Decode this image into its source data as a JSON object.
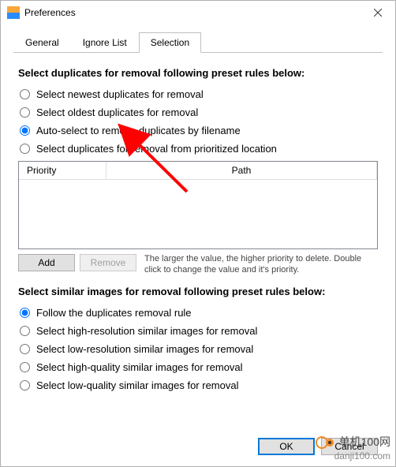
{
  "window": {
    "title": "Preferences"
  },
  "tabs": [
    {
      "label": "General",
      "active": false
    },
    {
      "label": "Ignore List",
      "active": false
    },
    {
      "label": "Selection",
      "active": true
    }
  ],
  "duplicates": {
    "heading": "Select duplicates for removal following preset rules below:",
    "options": [
      {
        "label": "Select newest duplicates for removal",
        "checked": false
      },
      {
        "label": "Select oldest duplicates for removal",
        "checked": false
      },
      {
        "label": "Auto-select to remove duplicates by filename",
        "checked": true
      },
      {
        "label": "Select duplicates for removal from prioritized location",
        "checked": false
      }
    ]
  },
  "priority_table": {
    "columns": {
      "priority": "Priority",
      "path": "Path"
    },
    "rows": []
  },
  "buttons": {
    "add": "Add",
    "remove": "Remove",
    "hint": "The larger the value, the higher priority to delete. Double click to change the value and it's priority."
  },
  "similar": {
    "heading": "Select similar images for removal following preset rules below:",
    "options": [
      {
        "label": "Follow the duplicates removal rule",
        "checked": true
      },
      {
        "label": "Select high-resolution similar images for removal",
        "checked": false
      },
      {
        "label": "Select low-resolution similar images for removal",
        "checked": false
      },
      {
        "label": "Select high-quality similar images for removal",
        "checked": false
      },
      {
        "label": "Select low-quality similar images for removal",
        "checked": false
      }
    ]
  },
  "footer": {
    "ok": "OK",
    "cancel": "Cancel"
  },
  "watermark": {
    "line1": "单机100网",
    "line2": "danji100.com"
  },
  "colors": {
    "accent": "#0078d7",
    "arrow": "#ff0000"
  }
}
